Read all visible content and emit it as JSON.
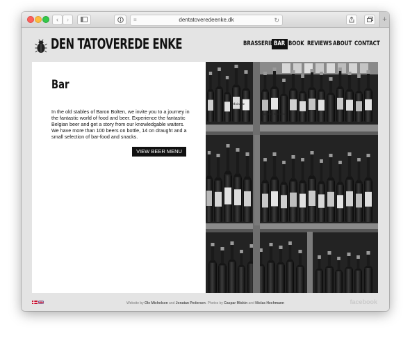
{
  "browser": {
    "url": "dentatoveredeenke.dk",
    "back_icon": "chevron-left",
    "forward_icon": "chevron-right",
    "sidebar_icon": "sidebar",
    "privacy_icon": "info",
    "reader_icon": "reader-lines",
    "reload_icon": "reload",
    "share_icon": "share",
    "tabs_icon": "tabs",
    "new_tab_icon": "plus"
  },
  "site": {
    "brand": "DEN TATOVEREDE ENKE",
    "logo_icon": "beetle",
    "nav": [
      {
        "label": "BRASSERIE"
      },
      {
        "label": "BAR"
      },
      {
        "label": "BOOK"
      },
      {
        "label": "REVIEWS"
      },
      {
        "label": "ABOUT"
      },
      {
        "label": "CONTACT"
      }
    ],
    "active_nav": "BAR"
  },
  "main": {
    "title": "Bar",
    "text": "In the old stables of Baron Bolten, we invite you to a journey in the fantastic world of food and beer. Experience the fantastic Belgian beer and get a story from our knowledgable waiters. We have more than 100 beers on bottle, 14 on draught and a small selection of bar-food and snacks.",
    "button": "VIEW BEER MENU",
    "photo_labels": [
      "Moinette",
      "Trappistes Rochefort",
      "Tripel"
    ]
  },
  "footer": {
    "credit_1": "Website by ",
    "name_1": "Ole Michelsen",
    "credit_2": " and ",
    "name_2": "Jonatan Pedersen",
    "credit_3": ". Photos by ",
    "name_3": "Caspar Miskin",
    "credit_4": " and ",
    "name_4": "Niclas Hechmann",
    "facebook": "facebook",
    "flags": [
      "danish-flag",
      "uk-flag"
    ]
  },
  "colors": {
    "accent": "#111111",
    "page_bg": "#e4e4e4",
    "panel_bg": "#ffffff"
  }
}
